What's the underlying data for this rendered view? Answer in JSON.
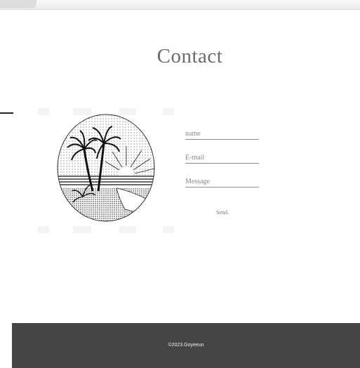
{
  "page": {
    "title": "Contact"
  },
  "form": {
    "name_placeholder": "name",
    "email_placeholder": "E-mail",
    "message_placeholder": "Message",
    "send_label": "Send."
  },
  "footer": {
    "copyright": "©2023.Goyeeun"
  },
  "icons": {
    "menu": "hamburger-menu-icon",
    "illustration": "palm-beach-sunset-illustration"
  },
  "colors": {
    "footer_bg": "#454545",
    "title": "#6a6a6a",
    "underline": "#8a8a8a"
  }
}
